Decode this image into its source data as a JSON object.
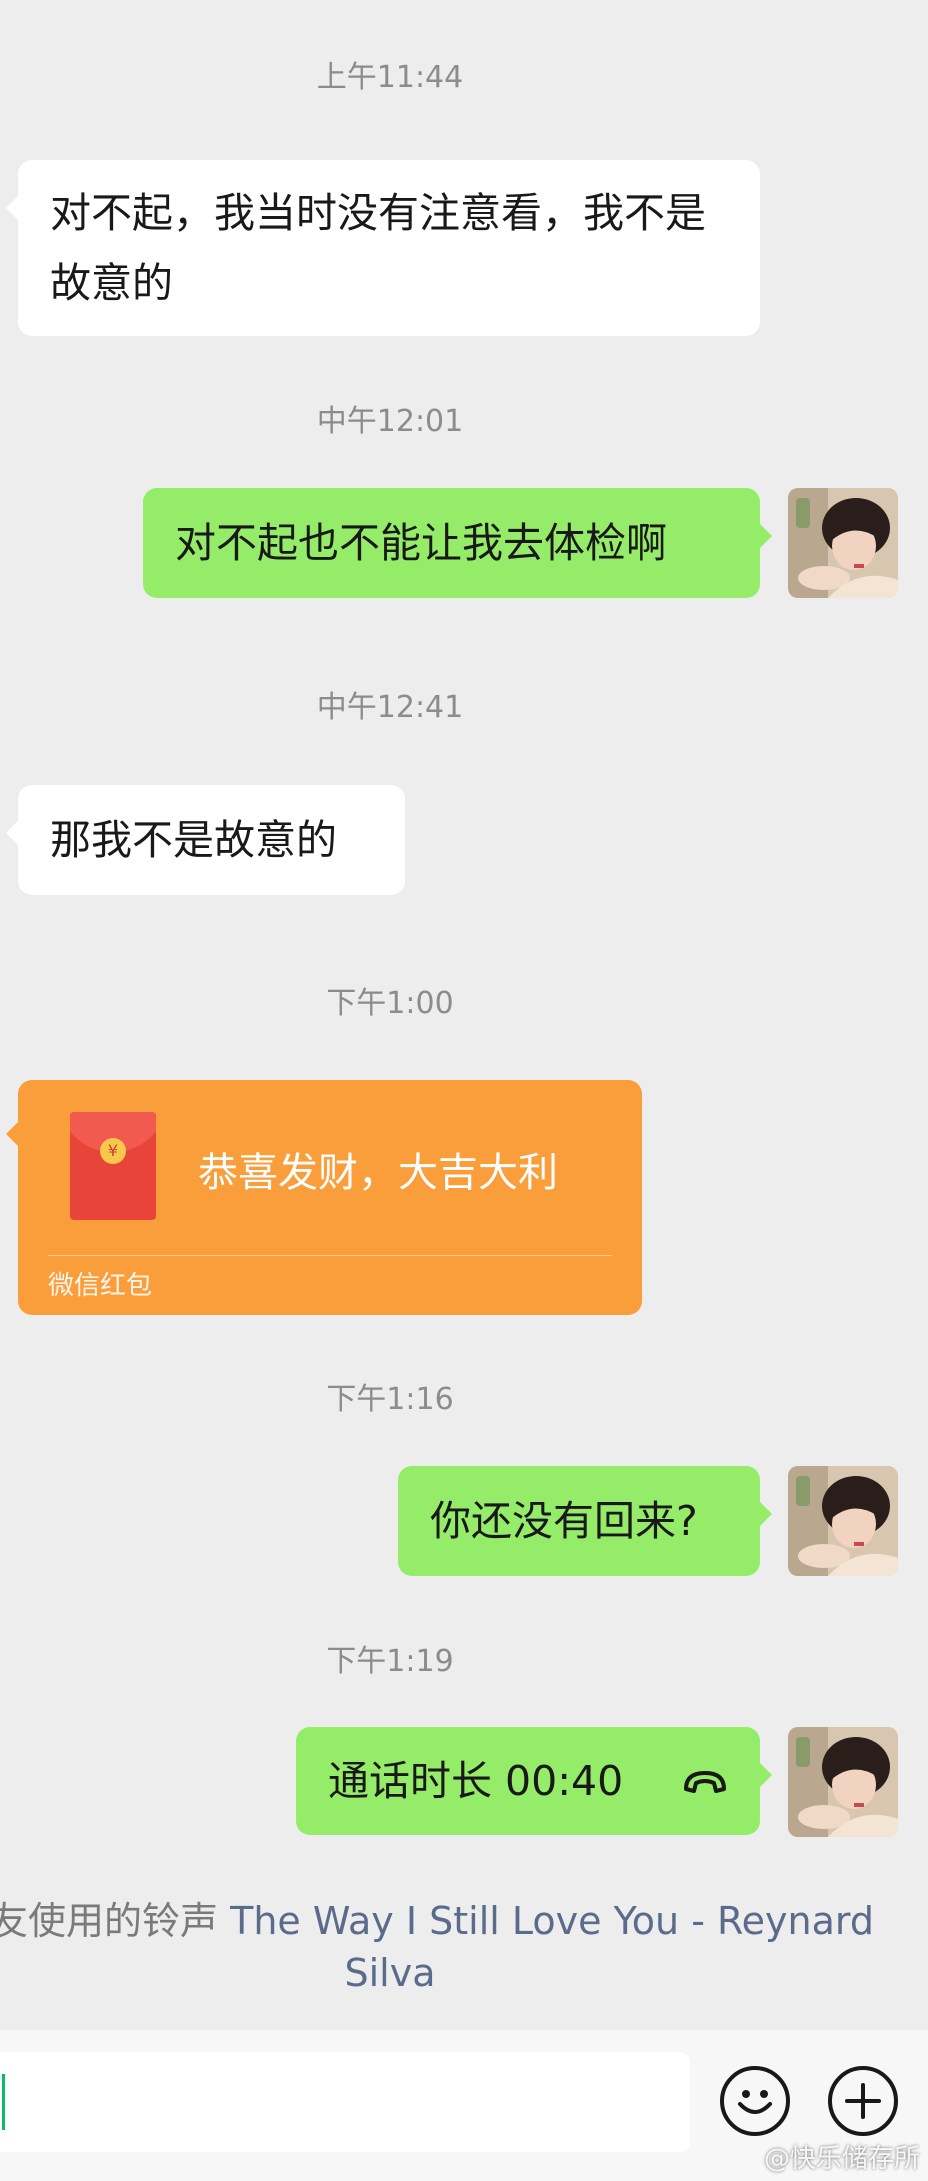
{
  "chat": {
    "ts1": "上午11:44",
    "msg1": "对不起，我当时没有注意看，我不是故意的",
    "ts2": "中午12:01",
    "msg2": "对不起也不能让我去体检啊",
    "ts3": "中午12:41",
    "msg3": "那我不是故意的",
    "ts4": "下午1:00",
    "red_packet": {
      "title": "恭喜发财，大吉大利",
      "label": "微信红包",
      "coin_symbol": "¥"
    },
    "ts5": "下午1:16",
    "msg5": "你还没有回来?",
    "ts6": "下午1:19",
    "call": {
      "label": "通话时长 00:40"
    }
  },
  "ringtone": {
    "prefix": "友使用的铃声",
    "song_line1": "The Way I Still Love You - Reynard",
    "song_line2": "Silva"
  },
  "input_bar": {
    "emoji_icon": "emoji-face-icon",
    "plus_icon": "plus-circle-icon"
  },
  "watermark": "@快乐储存所",
  "colors": {
    "background": "#ededed",
    "incoming_bubble": "#ffffff",
    "outgoing_bubble": "#95ec69",
    "red_packet": "#fa9d3b",
    "link": "#5b6b8c"
  }
}
